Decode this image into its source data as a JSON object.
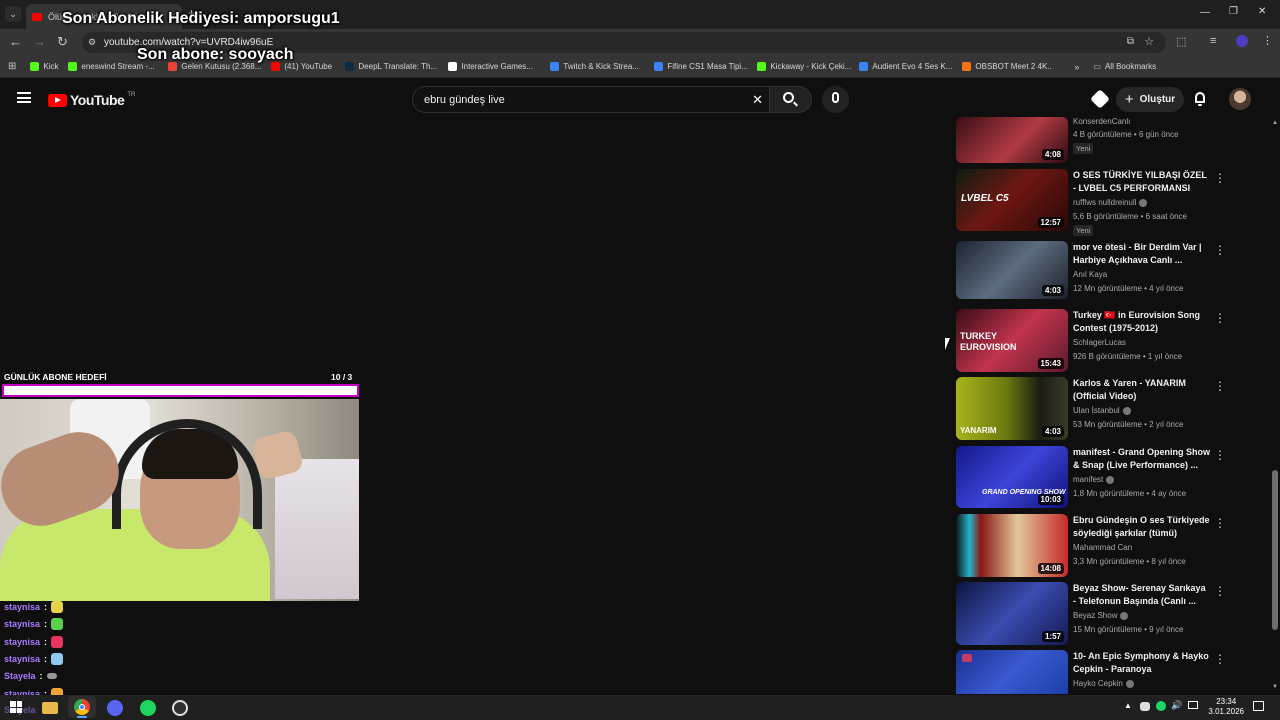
{
  "browser": {
    "tab_title": "Ölümüz Aşkla... Bu Günde",
    "url": "youtube.com/watch?v=UVRD4iw96uE",
    "bookmarks": [
      {
        "label": "Kick",
        "color": "#53fc18"
      },
      {
        "label": "eneswind Stream -...",
        "color": "#53fc18"
      },
      {
        "label": "Gelen Kutusu (2.368...",
        "color": "#ea4335"
      },
      {
        "label": "(41) YouTube",
        "color": "#ff0000"
      },
      {
        "label": "DeepL Translate: Th...",
        "color": "#0f2b46"
      },
      {
        "label": "Interactive Games...",
        "color": "#ffffff"
      },
      {
        "label": "Twitch & Kick Strea...",
        "color": "#3b82f6"
      },
      {
        "label": "Fifine CS1 Masa Tipi...",
        "color": "#3b82f6"
      },
      {
        "label": "Kickaway - Kick Çeki...",
        "color": "#53fc18"
      },
      {
        "label": "Audient Evo 4 Ses K...",
        "color": "#3b82f6"
      },
      {
        "label": "OBSBOT Meet 2 4K...",
        "color": "#f97316"
      }
    ],
    "all_bookmarks": "All Bookmarks"
  },
  "overlay": {
    "gift_text": "Son Abonelik Hediyesi: amporsugu1",
    "sub_text": "Son abone: sooyach"
  },
  "youtube": {
    "logo": "YouTube",
    "region": "TR",
    "search_value": "ebru gündeş live",
    "create_label": "Oluştur"
  },
  "recommendations": [
    {
      "title": "",
      "channel": "KonserdenCanlı",
      "meta": "4 B görüntüleme • 6 gün önce",
      "duration": "4:08",
      "badge": "Yeni",
      "verified": false,
      "thumb": "#6b1d24"
    },
    {
      "title": "O SES TÜRKİYE YILBAŞI ÖZEL - LVBEL C5 PERFORMANSI",
      "channel": "rufflws nulldreinull",
      "meta": "5,6 B görüntüleme • 6 saat önce",
      "duration": "12:57",
      "badge": "Yeni",
      "verified": true,
      "thumb": "#5a1512",
      "caption": "LVBEL C5"
    },
    {
      "title": "mor ve ötesi - Bir Derdim Var | Harbiye Açıkhava Canlı ...",
      "channel": "Anıl Kaya",
      "meta": "12 Mn görüntüleme • 4 yıl önce",
      "duration": "4:03",
      "badge": "",
      "verified": false,
      "thumb": "#34404d"
    },
    {
      "title": "Turkey 🇹🇷 in Eurovision Song Contest (1975-2012)",
      "channel": "SchlagerLucas",
      "meta": "926 B görüntüleme • 1 yıl önce",
      "duration": "15:43",
      "badge": "",
      "verified": false,
      "thumb": "#8a1a2e",
      "caption": "TURKEY EUROVISION"
    },
    {
      "title": "Karlos & Yaren - YANARIM (Official Video)",
      "channel": "Ulan İstanbul",
      "meta": "53 Mn görüntüleme • 2 yıl önce",
      "duration": "4:03",
      "badge": "",
      "verified": true,
      "thumb": "#8f9a1c",
      "caption": "YANARIM"
    },
    {
      "title": "manifest - Grand Opening Show & Snap (Live Performance) ...",
      "channel": "manifest",
      "meta": "1,8 Mn görüntüleme • 4 ay önce",
      "duration": "10:03",
      "badge": "",
      "verified": true,
      "thumb": "#2a2fb0",
      "caption": "GRAND OPENING SHOW"
    },
    {
      "title": "Ebru Gündeşin O ses Türkiyede söylediği şarkılar (tümü)",
      "channel": "Mahammad Can",
      "meta": "3,3 Mn görüntüleme • 8 yıl önce",
      "duration": "14:08",
      "badge": "",
      "verified": false,
      "thumb": "#b3201f"
    },
    {
      "title": "Beyaz Show- Serenay Sarıkaya - Telefonun Başında (Canlı ...",
      "channel": "Beyaz Show",
      "meta": "15 Mn görüntüleme • 9 yıl önce",
      "duration": "1:57",
      "badge": "",
      "verified": true,
      "thumb": "#2b3a8c"
    },
    {
      "title": "10- An Epic Symphony & Hayko Cepkin - Paranoya",
      "channel": "Hayko Cepkin",
      "meta": "",
      "duration": "",
      "badge": "",
      "verified": true,
      "thumb": "#1d3fa8"
    }
  ],
  "goal": {
    "label": "GÜNLÜK ABONE HEDEFİ",
    "count": "10  / 3"
  },
  "chat": [
    {
      "user": "staynisa",
      "emote": "#e6d34a"
    },
    {
      "user": "staynisa",
      "emote": "#56d34a"
    },
    {
      "user": "staynisa",
      "emote": "#e8345f"
    },
    {
      "user": "staynisa",
      "emote": "#8ec9f2"
    },
    {
      "user": "Stayela",
      "emote": "#999999"
    },
    {
      "user": "staynisa",
      "emote": "#f0a43a"
    },
    {
      "user": "Stayela",
      "emote": ""
    }
  ],
  "taskbar": {
    "time": "23:34",
    "date": "3.01.2026"
  }
}
